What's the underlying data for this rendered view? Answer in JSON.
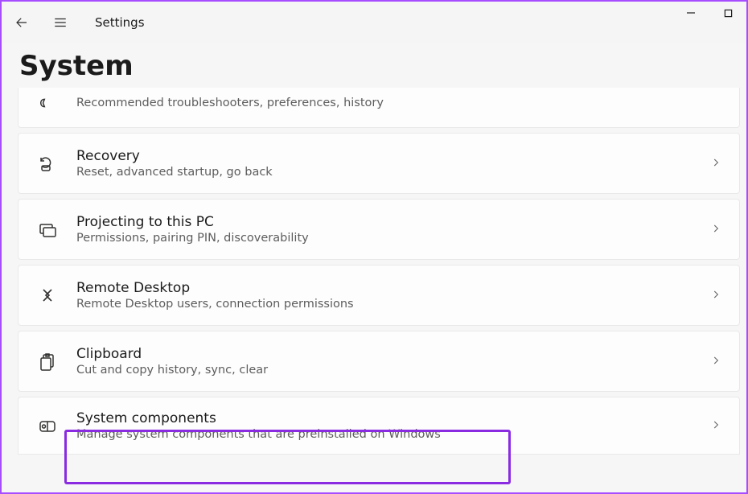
{
  "app_name": "Settings",
  "page_title": "System",
  "items": [
    {
      "title": "",
      "subtitle": "Recommended troubleshooters, preferences, history",
      "icon": "wrench",
      "cut_top": true,
      "chevron": false
    },
    {
      "title": "Recovery",
      "subtitle": "Reset, advanced startup, go back",
      "icon": "recovery",
      "chevron": true
    },
    {
      "title": "Projecting to this PC",
      "subtitle": "Permissions, pairing PIN, discoverability",
      "icon": "projecting",
      "chevron": true
    },
    {
      "title": "Remote Desktop",
      "subtitle": "Remote Desktop users, connection permissions",
      "icon": "remote-desktop",
      "chevron": true
    },
    {
      "title": "Clipboard",
      "subtitle": "Cut and copy history, sync, clear",
      "icon": "clipboard",
      "chevron": true
    },
    {
      "title": "System components",
      "subtitle": "Manage system components that are preinstalled on Windows",
      "icon": "system-components",
      "chevron": true,
      "cut_bottom": true
    }
  ]
}
